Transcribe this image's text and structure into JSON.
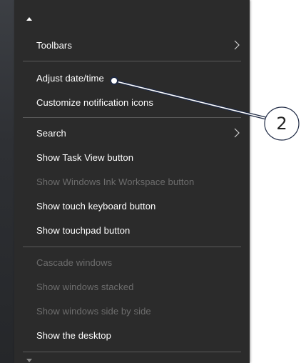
{
  "menu": {
    "items": [
      {
        "label": "Toolbars",
        "enabled": true,
        "submenu": true
      },
      {
        "label": "Adjust date/time",
        "enabled": true,
        "submenu": false
      },
      {
        "label": "Customize notification icons",
        "enabled": true,
        "submenu": false
      },
      {
        "label": "Search",
        "enabled": true,
        "submenu": true
      },
      {
        "label": "Show Task View button",
        "enabled": true,
        "submenu": false
      },
      {
        "label": "Show Windows Ink Workspace button",
        "enabled": false,
        "submenu": false
      },
      {
        "label": "Show touch keyboard button",
        "enabled": true,
        "submenu": false
      },
      {
        "label": "Show touchpad button",
        "enabled": true,
        "submenu": false
      },
      {
        "label": "Cascade windows",
        "enabled": false,
        "submenu": false
      },
      {
        "label": "Show windows stacked",
        "enabled": false,
        "submenu": false
      },
      {
        "label": "Show windows side by side",
        "enabled": false,
        "submenu": false
      },
      {
        "label": "Show the desktop",
        "enabled": true,
        "submenu": false
      }
    ]
  },
  "callout": {
    "number": "2",
    "target": "Adjust date/time"
  },
  "colors": {
    "menu_bg": "#2b2b2b",
    "text_enabled": "#ffffff",
    "text_disabled": "#6d6d6d",
    "separator": "#5a5a5a"
  }
}
